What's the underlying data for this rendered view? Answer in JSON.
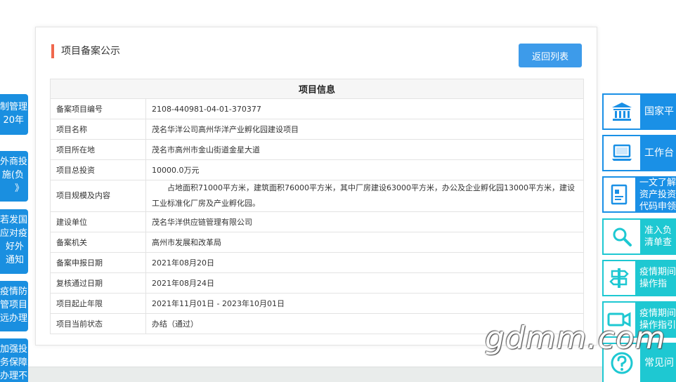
{
  "card": {
    "title": "项目备案公示",
    "back_label": "返回列表"
  },
  "table": {
    "header": "项目信息",
    "rows": [
      {
        "label": "备案项目编号",
        "value": "2108-440981-04-01-370377"
      },
      {
        "label": "项目名称",
        "value": "茂名华洋公司高州华洋产业孵化园建设项目"
      },
      {
        "label": "项目所在地",
        "value": "茂名市高州市金山街道金星大道"
      },
      {
        "label": "项目总投资",
        "value": "10000.0万元"
      },
      {
        "label": "项目规模及内容",
        "value": "占地面积71000平方米，建筑面积76000平方米，其中厂房建设63000平方米，办公及企业孵化园13000平方米，建设工业标准化厂房及产业孵化园。"
      },
      {
        "label": "建设单位",
        "value": "茂名华洋供应链管理有限公司"
      },
      {
        "label": "备案机关",
        "value": "高州市发展和改革局"
      },
      {
        "label": "备案申报日期",
        "value": "2021年08月20日"
      },
      {
        "label": "复核通过日期",
        "value": "2021年08月24日"
      },
      {
        "label": "项目起止年限",
        "value": "2021年11月01日 - 2023年10月01日"
      },
      {
        "label": "项目当前状态",
        "value": "办结（通过）"
      }
    ]
  },
  "left_notices": [
    {
      "lines": [
        "制管理",
        "20年"
      ]
    },
    {
      "lines": [
        "外商投",
        "施(负",
        "》"
      ]
    },
    {
      "lines": [
        "若发国",
        "应对疫",
        "好外",
        "通知"
      ]
    },
    {
      "lines": [
        "疫情防",
        "管项目",
        "远办理"
      ]
    },
    {
      "lines": [
        "加强投",
        "务保障",
        "办理不"
      ]
    }
  ],
  "right_panel": [
    {
      "lines": [
        "国家平"
      ],
      "icon": "government-building-icon"
    },
    {
      "lines": [
        "工作台"
      ],
      "icon": "laptop-icon"
    },
    {
      "lines": [
        "一文了解",
        "资产投资",
        "代码申领"
      ],
      "icon": "document-chart-icon"
    },
    {
      "lines": [
        "准入负",
        "清单查"
      ],
      "icon": "magnifier-icon"
    },
    {
      "lines": [
        "疫情期间",
        "操作指"
      ],
      "icon": "signpost-icon"
    },
    {
      "lines": [
        "疫情期间",
        "操作指引"
      ],
      "icon": "video-camera-icon"
    },
    {
      "lines": [
        "常见问"
      ],
      "icon": "question-mark-icon"
    }
  ],
  "watermark": "gdmm.com",
  "colors": {
    "accent_red": "#f0684d",
    "button_blue": "#3d9bea",
    "panel_blue": "#1a90e6",
    "panel_cyan": "#1ec8d2"
  }
}
